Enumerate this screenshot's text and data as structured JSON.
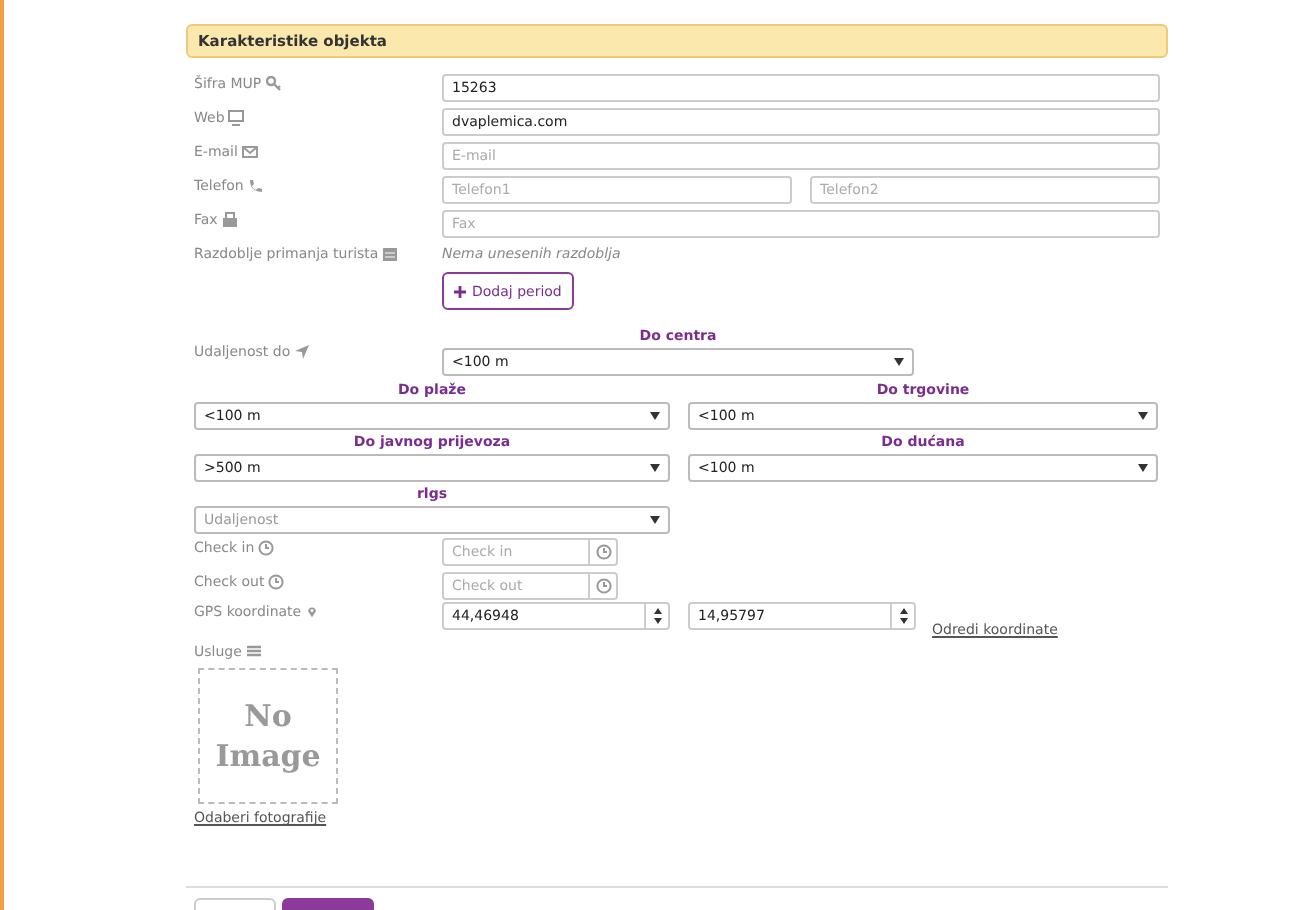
{
  "section_title": "Karakteristike objekta",
  "sifra": {
    "label": "Šifra MUP",
    "value": "15263"
  },
  "web": {
    "label": "Web",
    "value": "dvaplemica.com"
  },
  "email": {
    "label": "E-mail",
    "placeholder": "E-mail"
  },
  "telefon": {
    "label": "Telefon",
    "inputs": [
      {
        "placeholder": "Telefon1"
      },
      {
        "placeholder": "Telefon2"
      }
    ]
  },
  "fax": {
    "label": "Fax",
    "placeholder": "Fax"
  },
  "razdoblje": {
    "label": "Razdoblje primanja turista",
    "note": "Nema unesenih razdoblja",
    "button": "Dodaj period"
  },
  "udaljenost": {
    "label": "Udaljenost do",
    "centre": {
      "title": "Do centra",
      "value": "<100 m"
    },
    "selects": [
      {
        "title": "Do plaže",
        "value": "<100 m"
      },
      {
        "title": "Do trgovine",
        "value": "<100 m"
      },
      {
        "title": "Do javnog prijevoza",
        "value": ">500 m"
      },
      {
        "title": "Do dućana",
        "value": "<100 m"
      },
      {
        "title": "rlgs",
        "placeholder": "Udaljenost"
      }
    ]
  },
  "check_in": {
    "label": "Check in",
    "placeholder": "Check in"
  },
  "check_out": {
    "label": "Check out",
    "placeholder": "Check out"
  },
  "gps": {
    "label": "GPS koordinate",
    "values": [
      "44,46948",
      "14,95797"
    ],
    "link": "Odredi koordinate"
  },
  "usluge": {
    "label": "Usluge"
  },
  "image": {
    "text": "No Image",
    "link": "Odaberi fotografije"
  },
  "footer_buttons": [
    {
      "kind": "secondary"
    },
    {
      "kind": "primary"
    }
  ]
}
